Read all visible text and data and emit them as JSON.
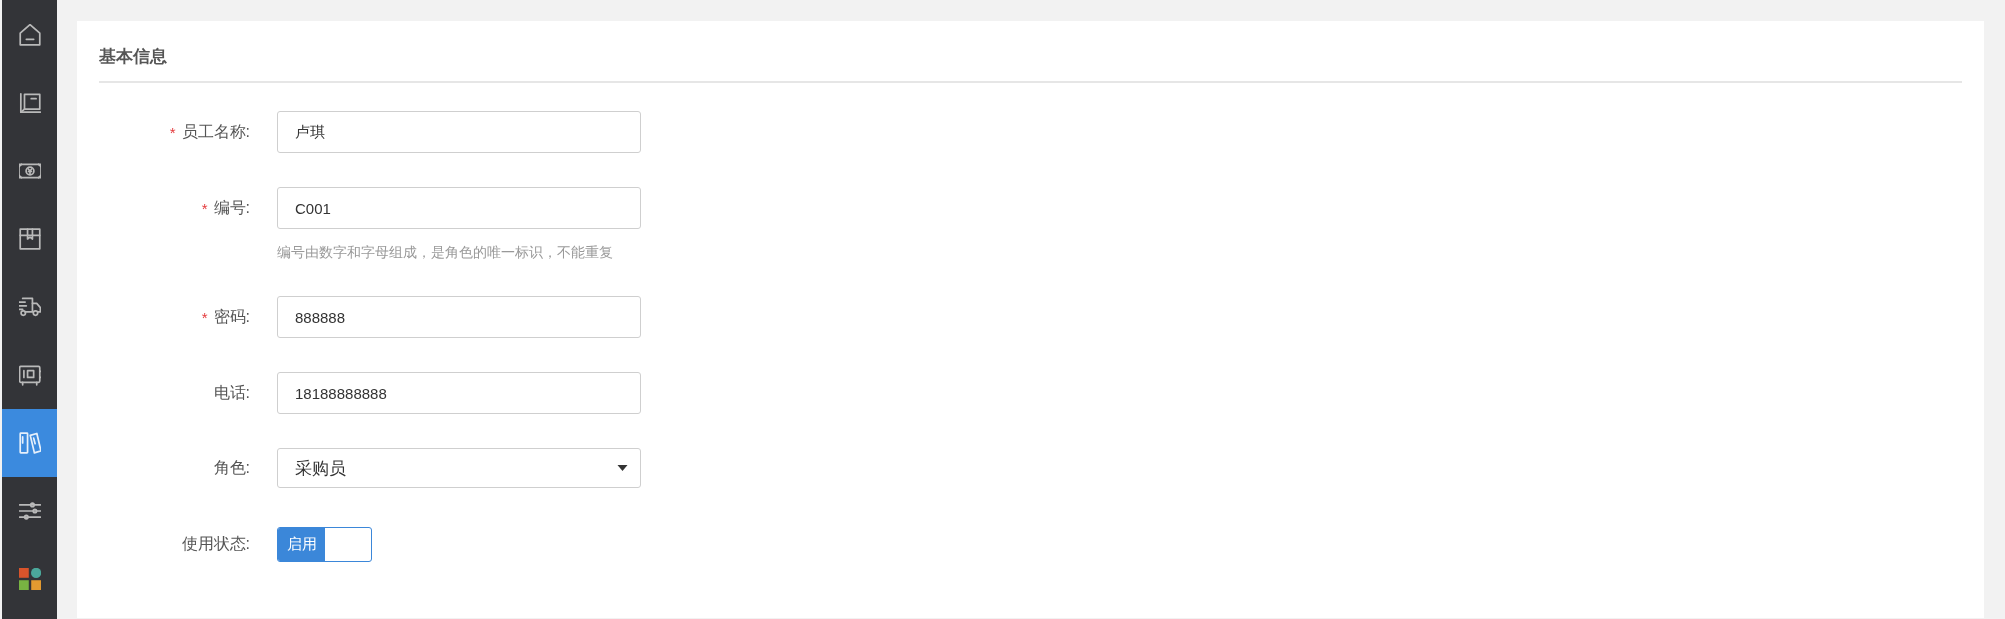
{
  "sidebar": {
    "items": [
      {
        "selected": false
      },
      {
        "selected": false
      },
      {
        "selected": false
      },
      {
        "selected": false
      },
      {
        "selected": false
      },
      {
        "selected": false
      },
      {
        "selected": true
      },
      {
        "selected": false
      },
      {
        "selected": false
      }
    ]
  },
  "section": {
    "title": "基本信息"
  },
  "form": {
    "fields": [
      {
        "kind": "input",
        "required_mark": "*",
        "label": "员工名称:",
        "value": "卢琪"
      },
      {
        "kind": "input",
        "required_mark": "*",
        "label": "编号:",
        "value": "C001",
        "help": "编号由数字和字母组成，是角色的唯一标识，不能重复"
      },
      {
        "kind": "input",
        "required_mark": "*",
        "label": "密码:",
        "value": "888888"
      },
      {
        "kind": "input",
        "label": "电话:",
        "value": "18188888888"
      },
      {
        "kind": "select",
        "label": "角色:",
        "value": "采购员"
      },
      {
        "kind": "toggle",
        "label": "使用状态:",
        "on": true,
        "text": "启用"
      }
    ]
  }
}
